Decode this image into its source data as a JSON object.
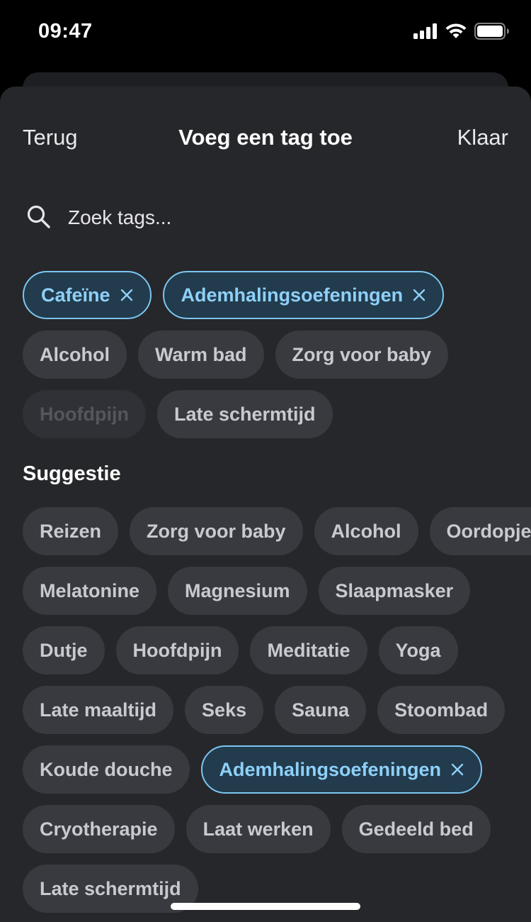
{
  "status": {
    "time": "09:47"
  },
  "nav": {
    "back_label": "Terug",
    "title": "Voeg een tag toe",
    "done_label": "Klaar"
  },
  "search": {
    "placeholder": "Zoek tags..."
  },
  "selected_tags": [
    {
      "label": "Cafeïne",
      "state": "active"
    },
    {
      "label": "Ademhalingsoefeningen",
      "state": "active"
    },
    {
      "label": "Alcohol",
      "state": "normal"
    },
    {
      "label": "Warm bad",
      "state": "normal"
    },
    {
      "label": "Zorg voor baby",
      "state": "normal"
    },
    {
      "label": "Hoofdpijn",
      "state": "disabled"
    },
    {
      "label": "Late schermtijd",
      "state": "normal"
    }
  ],
  "suggestions": {
    "title": "Suggestie",
    "items": [
      {
        "label": "Reizen",
        "state": "normal"
      },
      {
        "label": "Zorg voor baby",
        "state": "normal"
      },
      {
        "label": "Alcohol",
        "state": "normal"
      },
      {
        "label": "Oordopjes",
        "state": "normal"
      },
      {
        "label": "Melatonine",
        "state": "normal"
      },
      {
        "label": "Magnesium",
        "state": "normal"
      },
      {
        "label": "Slaapmasker",
        "state": "normal"
      },
      {
        "label": "Dutje",
        "state": "normal"
      },
      {
        "label": "Hoofdpijn",
        "state": "normal"
      },
      {
        "label": "Meditatie",
        "state": "normal"
      },
      {
        "label": "Yoga",
        "state": "normal"
      },
      {
        "label": "Late maaltijd",
        "state": "normal"
      },
      {
        "label": "Seks",
        "state": "normal"
      },
      {
        "label": "Sauna",
        "state": "normal"
      },
      {
        "label": "Stoombad",
        "state": "normal"
      },
      {
        "label": "Koude douche",
        "state": "normal"
      },
      {
        "label": "Ademhalingsoefeningen",
        "state": "active"
      },
      {
        "label": "Cryotherapie",
        "state": "normal"
      },
      {
        "label": "Laat werken",
        "state": "normal"
      },
      {
        "label": "Gedeeld bed",
        "state": "normal"
      },
      {
        "label": "Late schermtijd",
        "state": "normal"
      }
    ]
  },
  "colors": {
    "sheet_bg": "#26272b",
    "chip_bg": "#393a40",
    "chip_text": "#c9cad0",
    "accent": "#7cc6f0",
    "accent_text": "#8ed0f8"
  },
  "icons": {
    "search": "search-icon",
    "remove": "close-icon"
  }
}
